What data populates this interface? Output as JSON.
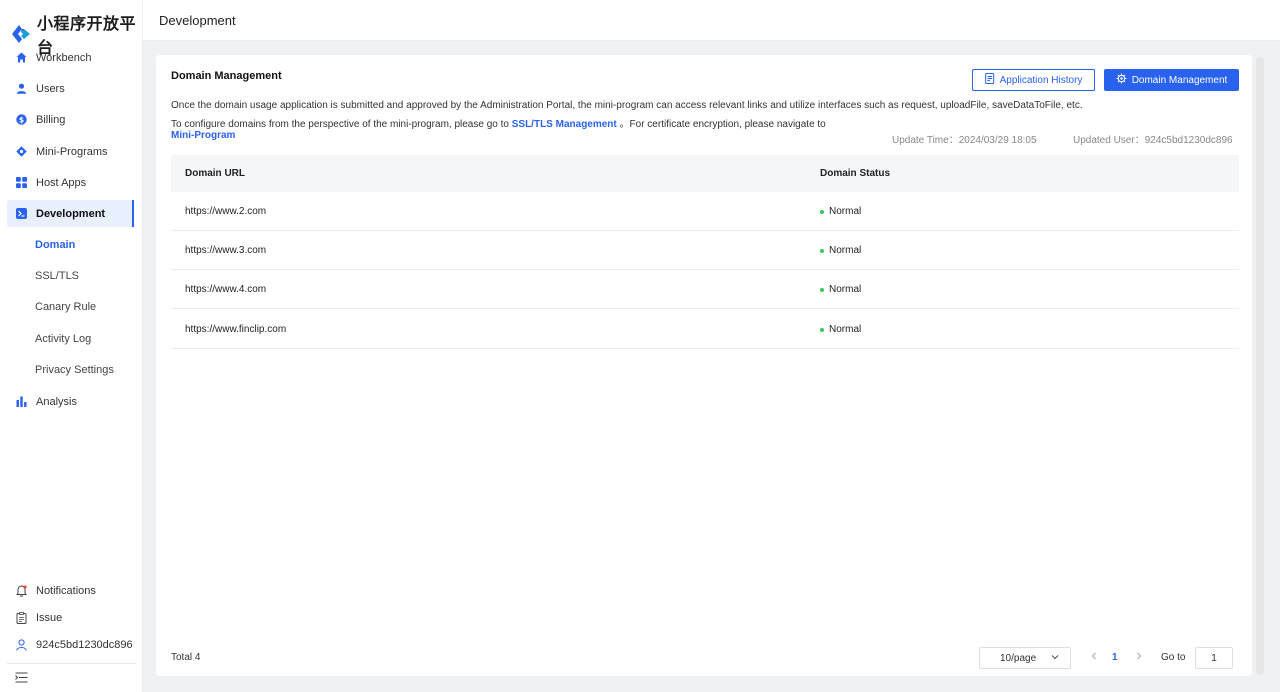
{
  "app": {
    "logo_text": "小程序开放平台"
  },
  "sidebar": {
    "items": [
      {
        "label": "Workbench",
        "icon": "home-icon"
      },
      {
        "label": "Users",
        "icon": "user-icon"
      },
      {
        "label": "Billing",
        "icon": "billing-icon"
      },
      {
        "label": "Mini-Programs",
        "icon": "diamond-icon"
      },
      {
        "label": "Host Apps",
        "icon": "grid-icon"
      },
      {
        "label": "Development",
        "icon": "terminal-icon"
      },
      {
        "label": "Analysis",
        "icon": "bar-chart-icon"
      }
    ],
    "subitems": [
      {
        "label": "Domain"
      },
      {
        "label": "SSL/TLS"
      },
      {
        "label": "Canary Rule"
      },
      {
        "label": "Activity Log"
      },
      {
        "label": "Privacy Settings"
      }
    ],
    "bottom": [
      {
        "label": "Notifications",
        "icon": "bell-icon"
      },
      {
        "label": "Issue",
        "icon": "clipboard-icon"
      },
      {
        "label": "924c5bd1230dc896",
        "icon": "person-outline-icon"
      }
    ]
  },
  "header": {
    "title": "Development"
  },
  "card": {
    "title": "Domain Management",
    "buttons": {
      "history": "Application History",
      "manage": "Domain Management"
    },
    "desc_line1": "Once the domain usage application is submitted and approved by the Administration Portal, the mini-program can access relevant links and utilize interfaces such as request, uploadFile, saveDataToFile, etc.",
    "desc_line2_pre": "To configure domains from the perspective of the mini-program, please go to",
    "desc_link1": "SSL/TLS Management",
    "desc_line2_post": "。For certificate encryption, please navigate to",
    "desc_link2": "Mini-Program",
    "update_time_label": "Update Time：",
    "update_time": "2024/03/29 18:05",
    "updated_user_label": "Updated User：",
    "updated_user": "924c5bd1230dc896"
  },
  "table": {
    "headers": {
      "url": "Domain URL",
      "status": "Domain Status"
    },
    "rows": [
      {
        "url": "https://www.2.com",
        "status": "Normal"
      },
      {
        "url": "https://www.3.com",
        "status": "Normal"
      },
      {
        "url": "https://www.4.com",
        "status": "Normal"
      },
      {
        "url": "https://www.finclip.com",
        "status": "Normal"
      }
    ]
  },
  "pagination": {
    "total": "Total 4",
    "page_size": "10/page",
    "current": "1",
    "goto_label": "Go to",
    "goto_value": "1"
  },
  "colors": {
    "accent": "#2a62f0",
    "status_ok": "#34c759"
  }
}
